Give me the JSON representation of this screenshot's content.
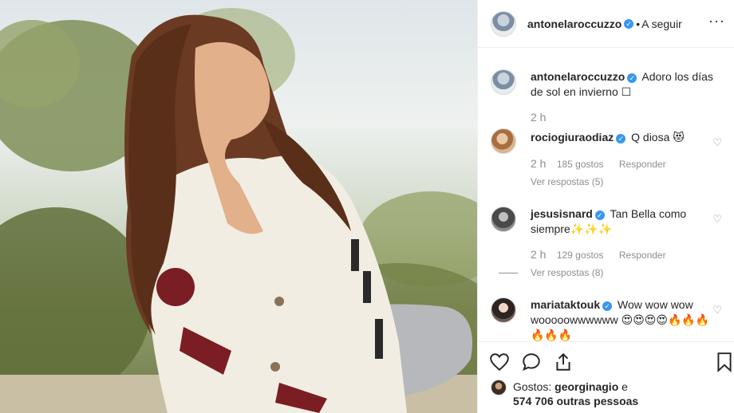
{
  "header": {
    "username": "antonelaroccuzzo",
    "separator": "•",
    "follow_label": "A seguir",
    "more_label": "···"
  },
  "caption": {
    "username": "antonelaroccuzzo",
    "text": "Adoro los días de sol en invierno ☐",
    "time": "2 h"
  },
  "comments": [
    {
      "username": "rociogiuraodiaz",
      "text": "Q diosa 😻",
      "time": "2 h",
      "likes": "185 gostos",
      "reply_label": "Responder",
      "view_replies": "Ver respostas (5)"
    },
    {
      "username": "jesusisnard",
      "text": "Tan Bella como siempre✨✨✨",
      "time": "2 h",
      "likes": "129 gostos",
      "reply_label": "Responder",
      "view_replies": "Ver respostas (8)"
    },
    {
      "username": "mariataktouk",
      "text": "Wow wow wow wooooowwwwww 😍😍😍😍🔥🔥🔥🔥🔥🔥",
      "time": "",
      "likes": "",
      "reply_label": "",
      "view_replies": ""
    }
  ],
  "likes": {
    "prefix": "Gostos: ",
    "first_user": "georginagio",
    "connector": " e",
    "others": "574 706 outras pessoas"
  },
  "colors": {
    "verified": "#3897f0",
    "text": "#262626",
    "muted": "#8e8e8e",
    "border": "#efefef"
  },
  "icons": [
    "heart-icon",
    "comment-icon",
    "share-icon",
    "bookmark-icon",
    "verified-icon",
    "more-icon"
  ]
}
